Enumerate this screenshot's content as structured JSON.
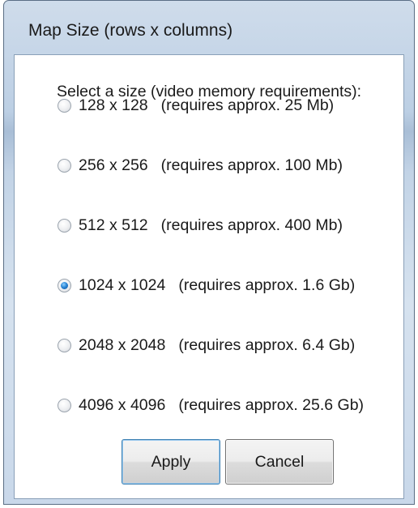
{
  "window": {
    "title": "Map Size (rows x columns)"
  },
  "dialog": {
    "prompt": "Select a size (video memory requirements):",
    "options": [
      {
        "size": "128 x 128",
        "requirement": "(requires approx. 25 Mb)",
        "checked": false
      },
      {
        "size": "256 x 256",
        "requirement": "(requires approx. 100 Mb)",
        "checked": false
      },
      {
        "size": "512 x 512",
        "requirement": "(requires approx. 400 Mb)",
        "checked": false
      },
      {
        "size": "1024 x 1024",
        "requirement": "(requires approx. 1.6 Gb)",
        "checked": true
      },
      {
        "size": "2048 x 2048",
        "requirement": "(requires approx. 6.4 Gb)",
        "checked": false
      },
      {
        "size": "4096 x 4096",
        "requirement": "(requires approx. 25.6 Gb)",
        "checked": false
      }
    ]
  },
  "buttons": {
    "apply_label": "Apply",
    "cancel_label": "Cancel"
  }
}
